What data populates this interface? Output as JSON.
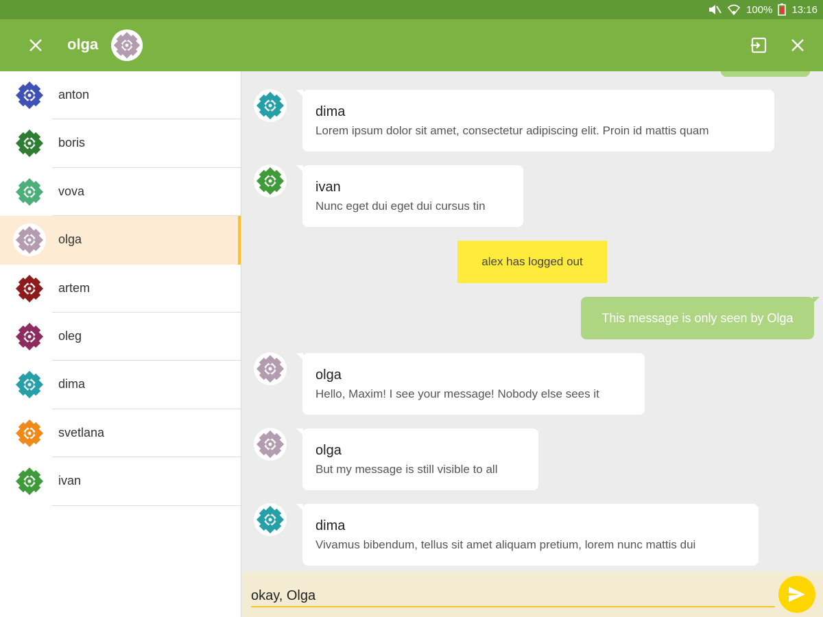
{
  "status_bar": {
    "battery": "100%",
    "time": "13:16"
  },
  "app_bar": {
    "title": "olga",
    "title_avatar_color": "#b39cb0"
  },
  "sidebar": {
    "users": [
      {
        "name": "anton",
        "color": "#3f51b5"
      },
      {
        "name": "boris",
        "color": "#2e7d32"
      },
      {
        "name": "vova",
        "color": "#4caf7a"
      },
      {
        "name": "olga",
        "color": "#b39cb0",
        "active": true
      },
      {
        "name": "artem",
        "color": "#8e1b1b"
      },
      {
        "name": "oleg",
        "color": "#8e2b5f"
      },
      {
        "name": "dima",
        "color": "#26a0a8"
      },
      {
        "name": "svetlana",
        "color": "#ef8a1a"
      },
      {
        "name": "ivan",
        "color": "#3f9a3a"
      }
    ]
  },
  "chat": {
    "messages": [
      {
        "sender": "dima",
        "text": "Lorem ipsum dolor sit amet, consectetur adipiscing elit. Proin id mattis quam",
        "color": "#26a0a8"
      },
      {
        "sender": "ivan",
        "text": "Nunc eget dui eget dui cursus tin",
        "color": "#3f9a3a"
      },
      {
        "sender": "olga",
        "text": "Hello, Maxim! I see your message! Nobody else sees it",
        "color": "#b39cb0"
      },
      {
        "sender": "olga",
        "text": "But my message is still visible to all",
        "color": "#b39cb0"
      },
      {
        "sender": "dima",
        "text": "Vivamus bibendum, tellus sit amet aliquam pretium, lorem nunc mattis dui",
        "color": "#26a0a8"
      }
    ],
    "system_message": "alex has logged out",
    "own_message": "This message is only seen by Olga"
  },
  "input": {
    "value": "okay, Olga"
  },
  "colors": {
    "status_bar": "#5f9a35",
    "app_bar": "#7cb342",
    "own_bubble": "#aed581",
    "system": "#ffeb3b",
    "send": "#ffd600",
    "active_row": "#fdebd3"
  }
}
